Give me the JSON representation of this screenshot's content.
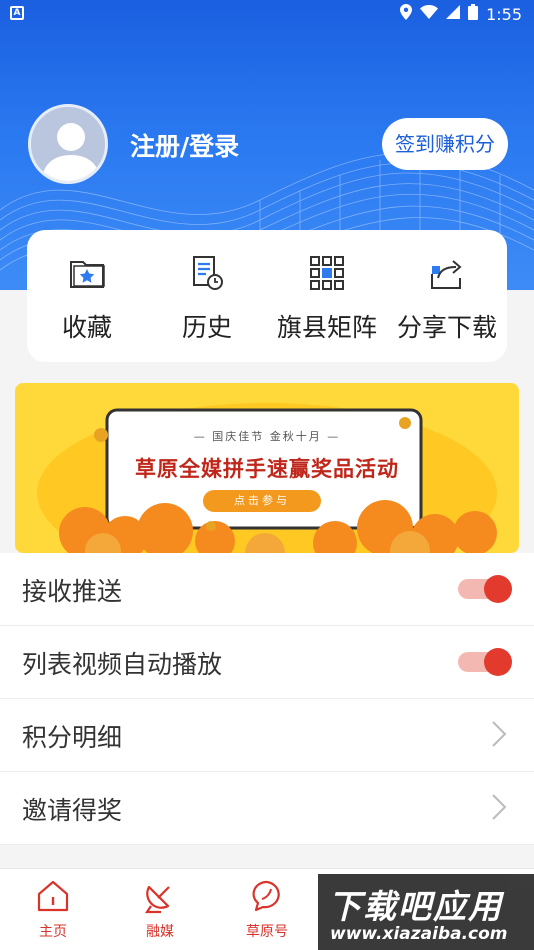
{
  "status_bar": {
    "notification": "A",
    "time": "1:55"
  },
  "header": {
    "login_text": "注册/登录",
    "checkin_label": "签到赚积分"
  },
  "quick_actions": [
    {
      "label": "收藏",
      "icon": "favorites-folder-icon"
    },
    {
      "label": "历史",
      "icon": "history-document-icon"
    },
    {
      "label": "旗县矩阵",
      "icon": "matrix-grid-icon"
    },
    {
      "label": "分享下载",
      "icon": "share-icon"
    }
  ],
  "banner": {
    "subtitle": "— 国庆佳节   金秋十月 —",
    "title": "草原全媒拼手速赢奖品活动",
    "button": "点击参与"
  },
  "settings": [
    {
      "label": "接收推送",
      "type": "toggle",
      "on": true
    },
    {
      "label": "列表视频自动播放",
      "type": "toggle",
      "on": true
    },
    {
      "label": "积分明细",
      "type": "link"
    },
    {
      "label": "邀请得奖",
      "type": "link"
    }
  ],
  "bottom_nav": [
    {
      "label": "主页",
      "icon": "home-icon"
    },
    {
      "label": "融媒",
      "icon": "satellite-dish-icon"
    },
    {
      "label": "草原号",
      "icon": "chat-bubble-icon"
    }
  ],
  "watermark": {
    "big": "下载吧应用",
    "small": "www.xiazaiba.com"
  },
  "colors": {
    "header_blue": "#2a78f0",
    "accent_red": "#e33a2e",
    "banner_yellow": "#ffd93a"
  }
}
